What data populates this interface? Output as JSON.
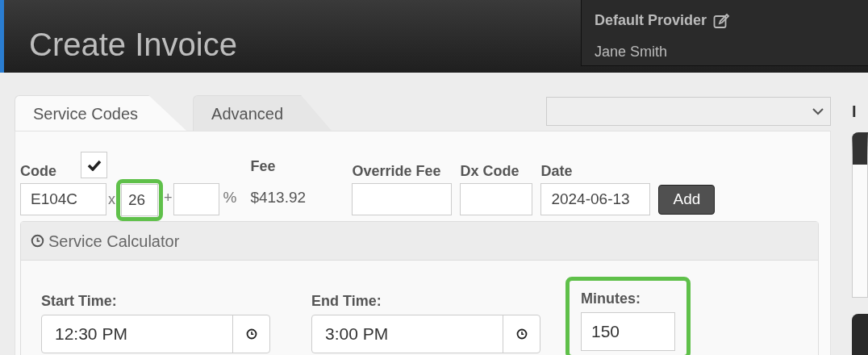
{
  "header": {
    "title": "Create Invoice",
    "provider_label": "Default Provider",
    "provider_name": "Jane Smith"
  },
  "tabs": [
    {
      "label": "Service Codes",
      "selected": true
    },
    {
      "label": "Advanced",
      "selected": false
    }
  ],
  "service": {
    "code": {
      "label": "Code",
      "value": "E104C"
    },
    "default_checked": true,
    "times_sign": "x",
    "quantity": {
      "value": "26",
      "highlighted": true
    },
    "plus_sign": "+",
    "percent_sign": "%",
    "fee": {
      "label": "Fee",
      "value": "$413.92"
    },
    "override_fee": {
      "label": "Override Fee"
    },
    "dx_code": {
      "label": "Dx Code"
    },
    "date": {
      "label": "Date",
      "value": "2024-06-13"
    },
    "add_button": "Add"
  },
  "calculator": {
    "title": "Service Calculator",
    "start": {
      "label": "Start Time:",
      "value": "12:30 PM"
    },
    "end": {
      "label": "End Time:",
      "value": "3:00 PM"
    },
    "minutes": {
      "label": "Minutes:",
      "value": "150",
      "highlighted": true
    }
  },
  "side_heading": "I"
}
